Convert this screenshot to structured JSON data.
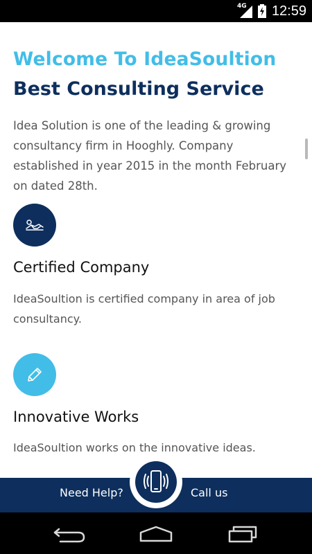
{
  "status_bar": {
    "time": "12:59",
    "network": "4G",
    "icons": [
      "signal-icon",
      "battery-charging-icon"
    ]
  },
  "hero": {
    "welcome": "Welcome To IdeaSoultion",
    "headline": "Best Consulting Service",
    "intro": "Idea Solution is one of the leading & growing consultancy firm in Hooghly. Company established in year 2015 in the month February on dated 28th."
  },
  "features": [
    {
      "icon": "handshake-icon",
      "title": "Certified Company",
      "text": "IdeaSoultion is certified company in area of job consultancy."
    },
    {
      "icon": "pencil-icon",
      "title": "Innovative Works",
      "text": "IdeaSoultion works on the innovative ideas."
    }
  ],
  "help_bar": {
    "need_help": "Need Help?",
    "call_us": "Call us",
    "icon": "phone-vibrate-icon"
  },
  "nav_bar": {
    "icons": [
      "back-icon",
      "home-icon",
      "recents-icon"
    ]
  },
  "colors": {
    "accent_light": "#42bde8",
    "accent_dark": "#0e2f5d",
    "body_text": "#555555"
  }
}
